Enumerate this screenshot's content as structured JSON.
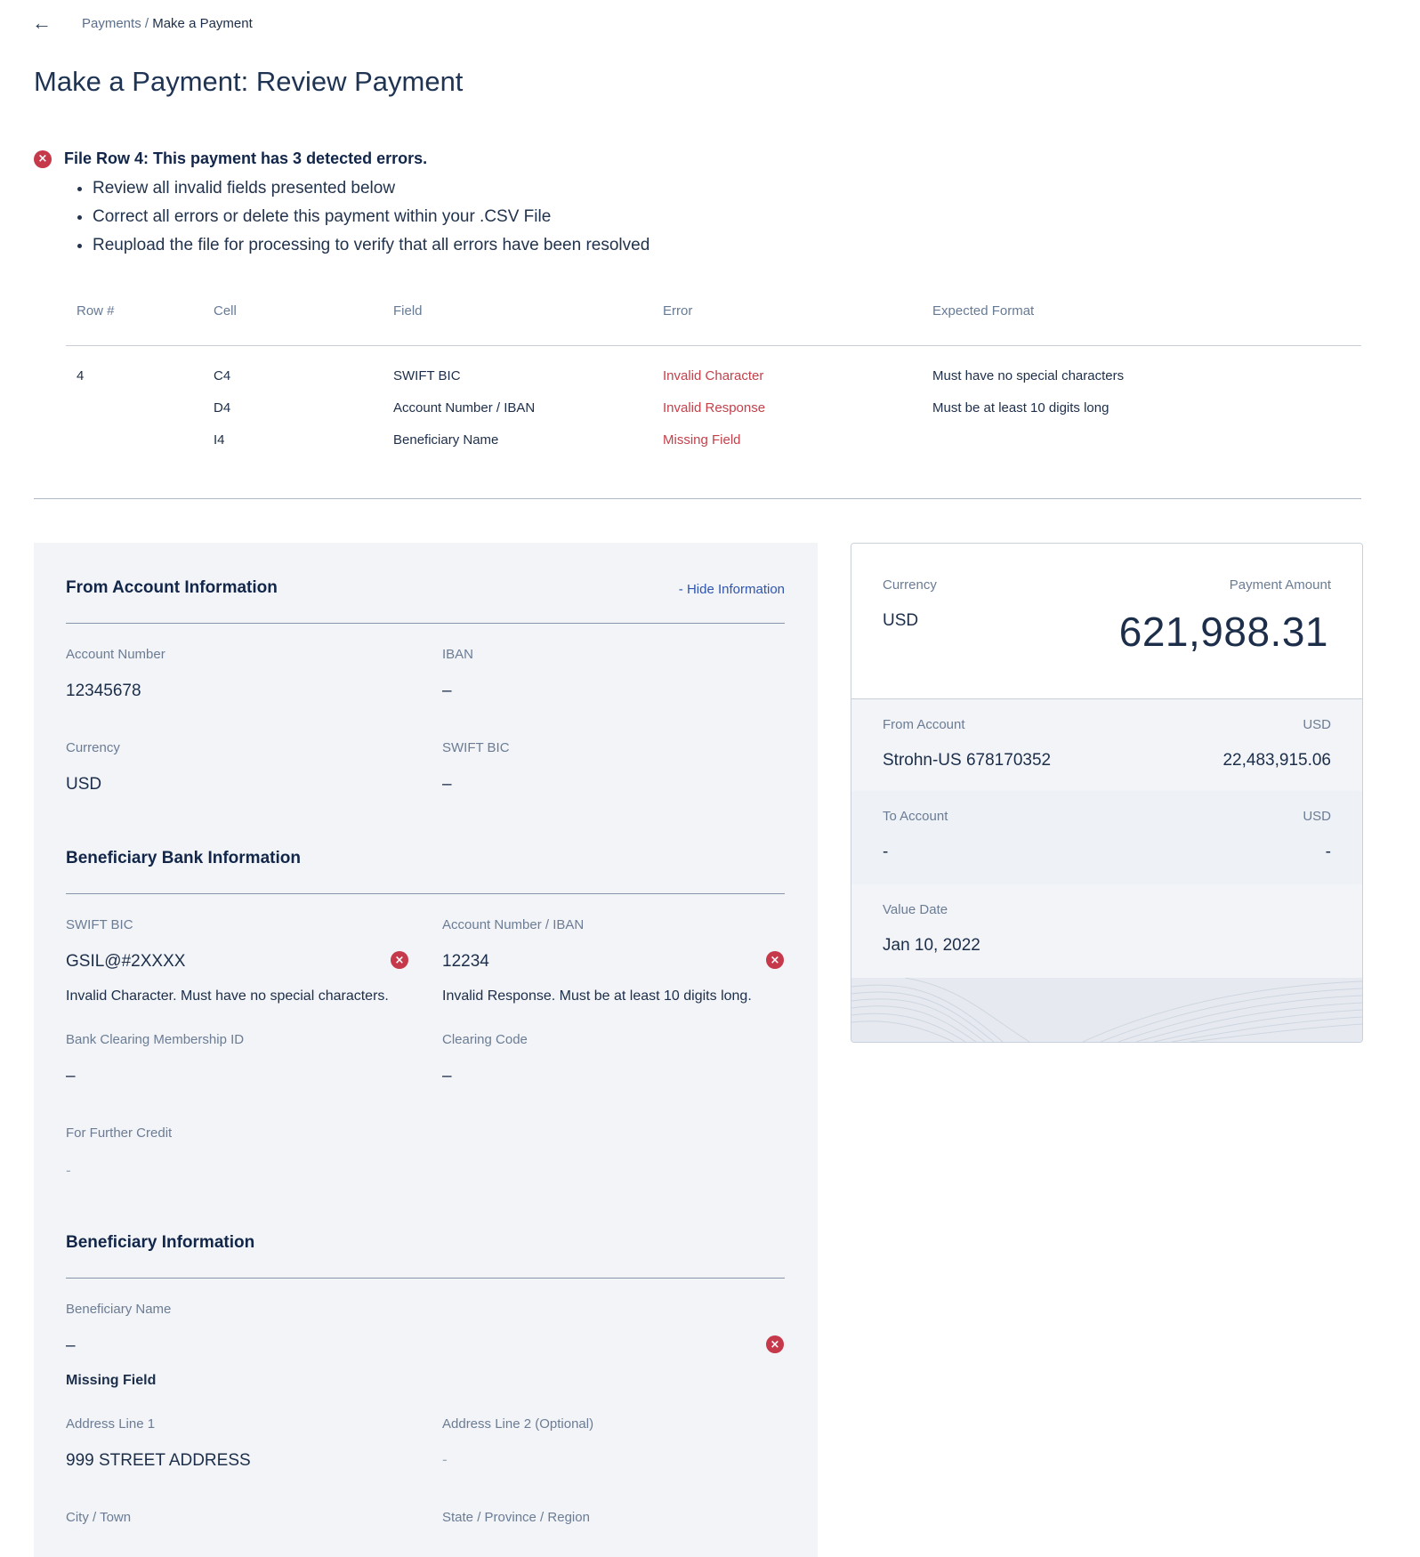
{
  "breadcrumb": {
    "back_icon": "←",
    "parent": "Payments",
    "separator": " / ",
    "current": "Make a Payment"
  },
  "page_title": "Make a Payment: Review Payment",
  "error_summary": {
    "heading": "File Row 4: This payment has 3 detected errors.",
    "bullets": [
      "Review all invalid fields presented below",
      "Correct all errors or delete this payment within your .CSV File",
      "Reupload the file for processing to verify that all errors have been resolved"
    ]
  },
  "error_table": {
    "headers": [
      "Row #",
      "Cell",
      "Field",
      "Error",
      "Expected Format"
    ],
    "rows": [
      {
        "row": "4",
        "cell": "C4",
        "field": "SWIFT BIC",
        "error": "Invalid Character",
        "expected": "Must have no special characters"
      },
      {
        "row": "",
        "cell": "D4",
        "field": "Account Number / IBAN",
        "error": "Invalid Response",
        "expected": "Must be at least 10 digits long"
      },
      {
        "row": "",
        "cell": "I4",
        "field": "Beneficiary Name",
        "error": "Missing Field",
        "expected": ""
      }
    ]
  },
  "from_account": {
    "title": "From Account Information",
    "hide_link": "- Hide Information",
    "account_number_label": "Account Number",
    "account_number": "12345678",
    "iban_label": "IBAN",
    "iban": "–",
    "currency_label": "Currency",
    "currency": "USD",
    "swift_label": "SWIFT BIC",
    "swift": "–"
  },
  "beneficiary_bank": {
    "title": "Beneficiary Bank Information",
    "swift_label": "SWIFT BIC",
    "swift": "GSIL@#2XXXX",
    "swift_error": "Invalid Character. Must have no special characters.",
    "account_label": "Account Number / IBAN",
    "account": "12234",
    "account_error": "Invalid Response. Must be at least 10 digits long.",
    "clearing_id_label": "Bank Clearing Membership ID",
    "clearing_id": "–",
    "clearing_code_label": "Clearing Code",
    "clearing_code": "–",
    "further_credit_label": "For Further Credit",
    "further_credit": "-"
  },
  "beneficiary": {
    "title": "Beneficiary Information",
    "name_label": "Beneficiary Name",
    "name": "–",
    "name_error": "Missing Field",
    "address1_label": "Address Line 1",
    "address1": "999 STREET ADDRESS",
    "address2_label": "Address Line 2 (Optional)",
    "address2": "-",
    "city_label": "City / Town",
    "state_label": "State / Province / Region"
  },
  "summary_card": {
    "currency_label": "Currency",
    "currency": "USD",
    "amount_label": "Payment Amount",
    "amount": "621,988.31",
    "from_label": "From Account",
    "from_currency": "USD",
    "from_account": "Strohn-US 678170352",
    "from_balance": "22,483,915.06",
    "to_label": "To Account",
    "to_currency": "USD",
    "to_account": "-",
    "to_balance": "-",
    "value_date_label": "Value Date",
    "value_date": "Jan 10, 2022"
  },
  "icons": {
    "error_icon": "error-circle-x-icon",
    "error_glyph": "×",
    "error_color": "#c5394a"
  }
}
